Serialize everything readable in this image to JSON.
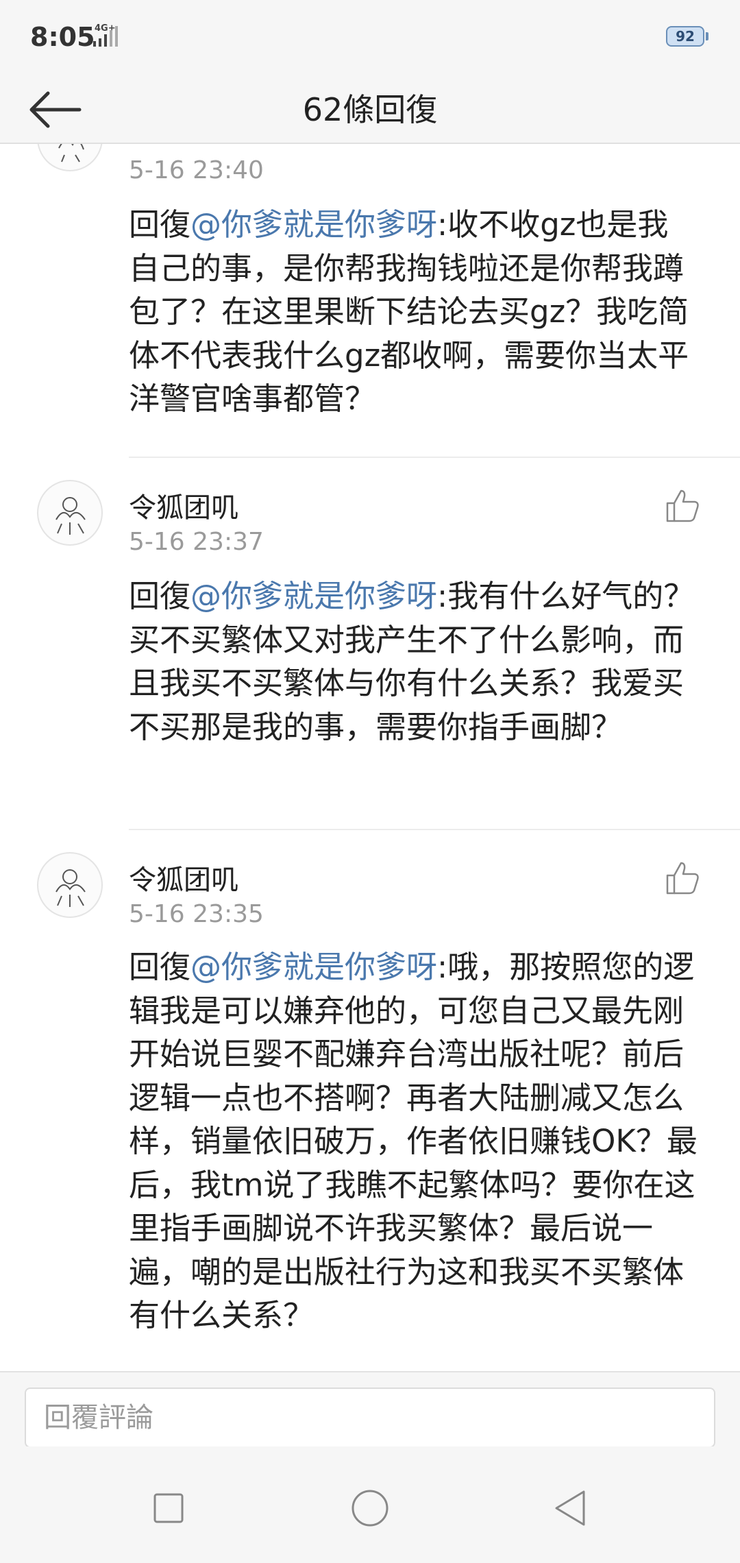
{
  "status_bar": {
    "time": "8:05",
    "network": "4G+",
    "battery": "92"
  },
  "header": {
    "title": "62條回復"
  },
  "comments": [
    {
      "username": "",
      "timestamp": "5-16 23:40",
      "reply_prefix": "回復",
      "mention": "@你爹就是你爹呀",
      "text": ":收不收gz也是我自己的事，是你帮我掏钱啦还是你帮我蹲包了？在这里果断下结论去买gz？我吃简体不代表我什么gz都收啊，需要你当太平洋警官啥事都管？"
    },
    {
      "username": "令狐团叽",
      "timestamp": "5-16 23:37",
      "reply_prefix": "回復",
      "mention": "@你爹就是你爹呀",
      "text": ":我有什么好气的？买不买繁体又对我产生不了什么影响，而且我买不买繁体与你有什么关系？我爱买不买那是我的事，需要你指手画脚？"
    },
    {
      "username": "令狐团叽",
      "timestamp": "5-16 23:35",
      "reply_prefix": "回復",
      "mention": "@你爹就是你爹呀",
      "text": ":哦，那按照您的逻辑我是可以嫌弃他的，可您自己又最先刚开始说巨婴不配嫌弃台湾出版社呢？前后逻辑一点也不搭啊？再者大陆删减又怎么样，销量依旧破万，作者依旧赚钱OK？最后，我tm说了我瞧不起繁体吗？要你在这里指手画脚说不许我买繁体？最后说一遍，嘲的是出版社行为这和我买不买繁体有什么关系？"
    }
  ],
  "reply_bar": {
    "placeholder": "回覆評論"
  },
  "icons": {
    "back": "back-arrow-icon",
    "like": "thumbs-up-icon",
    "nav_recent": "square-icon",
    "nav_home": "circle-icon",
    "nav_back": "triangle-back-icon"
  },
  "colors": {
    "mention": "#4a78ad",
    "timestamp": "#9a9a9a",
    "header_bg": "#f6f6f6"
  }
}
